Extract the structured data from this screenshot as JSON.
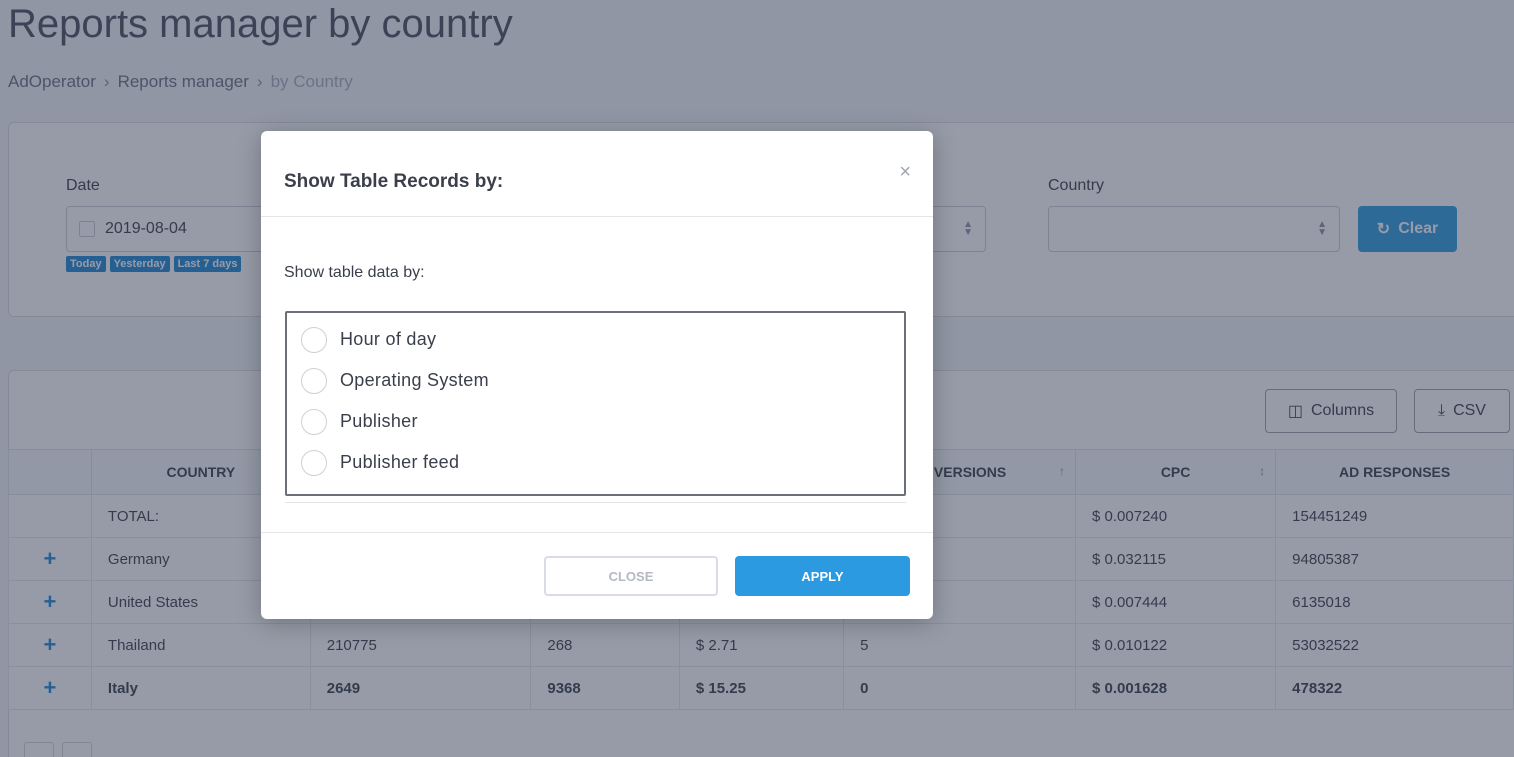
{
  "page": {
    "title": "Reports manager by country",
    "breadcrumb": [
      "AdOperator",
      "Reports manager",
      "by Country"
    ]
  },
  "filters": {
    "date_label": "Date",
    "date_value": "2019-08-04",
    "quick_ranges": [
      "Today",
      "Yesterday",
      "Last 7 days"
    ],
    "country_label": "Country",
    "country_value": "",
    "clear_label": "Clear"
  },
  "toolbar": {
    "columns_label": "Columns",
    "csv_label": "CSV"
  },
  "table": {
    "headers": [
      "",
      "COUNTRY",
      "",
      "",
      "",
      "ONVERSIONS",
      "CPC",
      "AD RESPONSES"
    ],
    "rows": [
      {
        "expand": "",
        "country": "TOTAL:",
        "c2": "",
        "c3": "",
        "c4": "",
        "conversions": "",
        "cpc": "$ 0.007240",
        "ad_responses": "154451249"
      },
      {
        "expand": "+",
        "country": "Germany",
        "c2": "",
        "c3": "",
        "c4": "",
        "conversions": "",
        "cpc": "$ 0.032115",
        "ad_responses": "94805387"
      },
      {
        "expand": "+",
        "country": "United States",
        "c2": "",
        "c3": "",
        "c4": "",
        "conversions": "",
        "cpc": "$ 0.007444",
        "ad_responses": "6135018"
      },
      {
        "expand": "+",
        "country": "Thailand",
        "c2": "210775",
        "c3": "268",
        "c4": "$ 2.71",
        "conversions": "5",
        "cpc": "$ 0.010122",
        "ad_responses": "53032522"
      },
      {
        "expand": "+",
        "country": "Italy",
        "c2": "2649",
        "c3": "9368",
        "c4": "$ 15.25",
        "conversions": "0",
        "cpc": "$ 0.001628",
        "ad_responses": "478322"
      }
    ]
  },
  "modal": {
    "title": "Show Table Records by:",
    "close_icon": "×",
    "subtitle": "Show table data by:",
    "options": [
      "Hour of day",
      "Operating System",
      "Publisher",
      "Publisher feed"
    ],
    "close_label": "CLOSE",
    "apply_label": "APPLY"
  }
}
